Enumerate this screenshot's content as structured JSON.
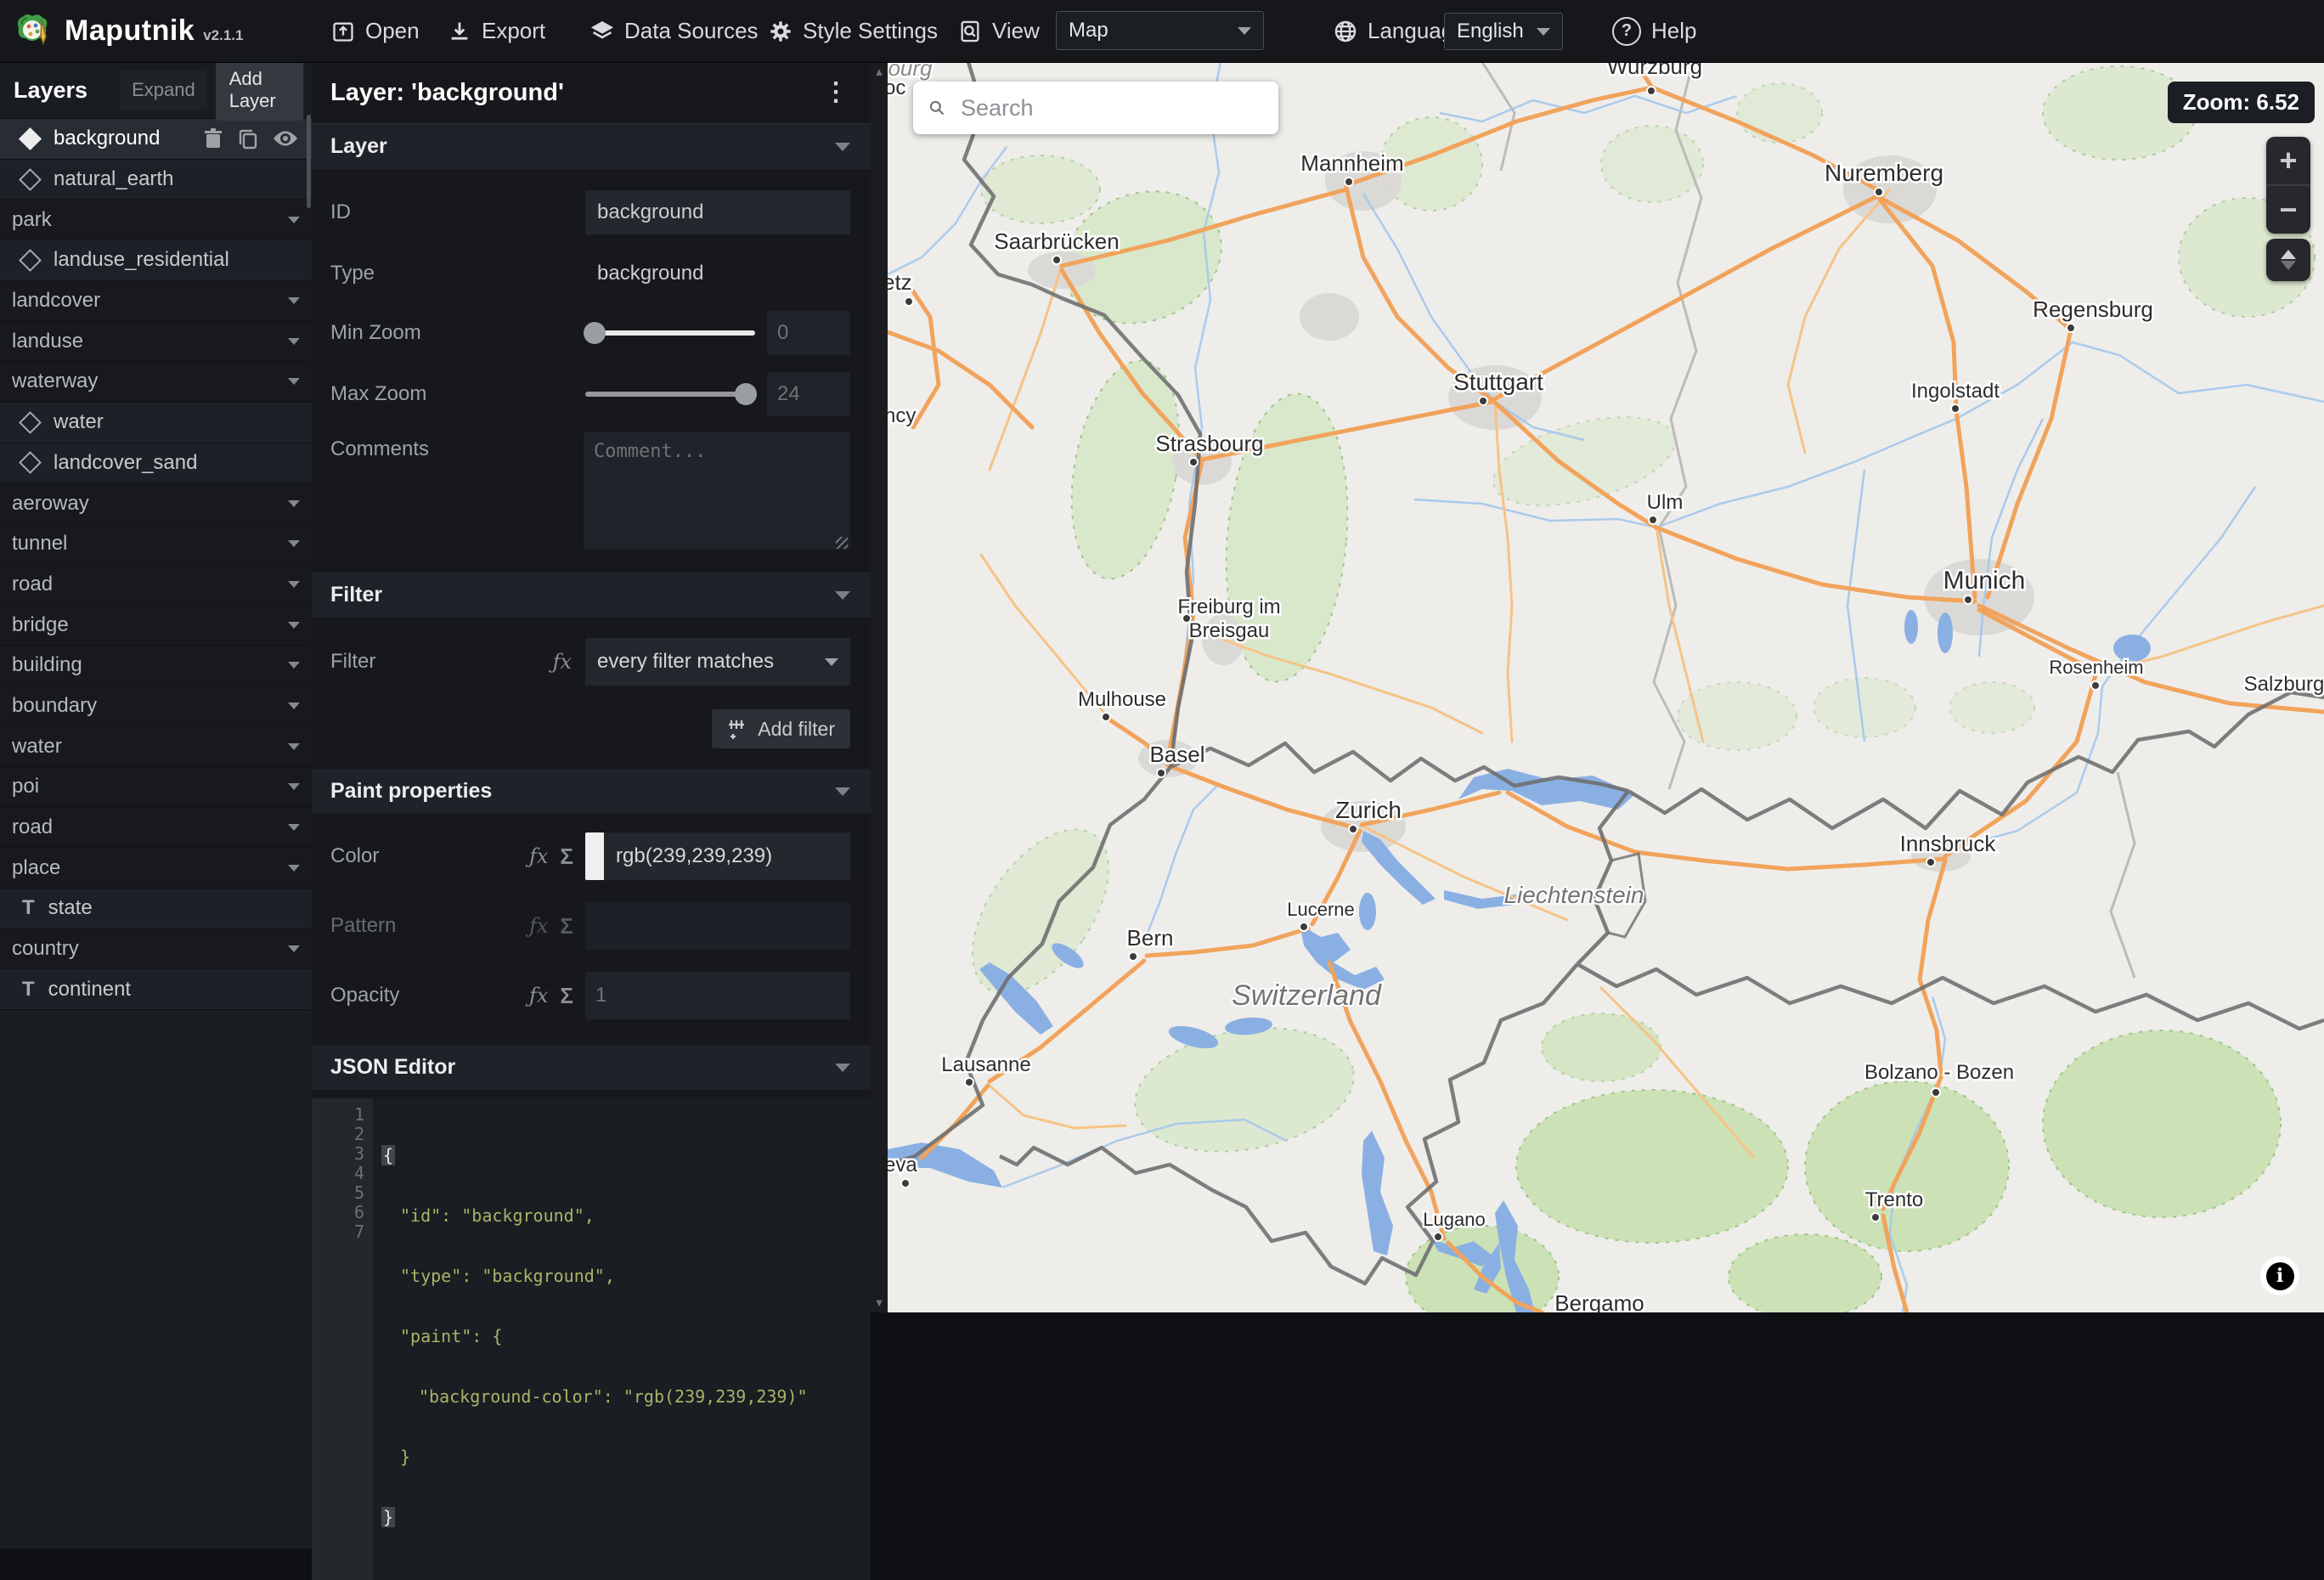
{
  "topbar": {
    "title": "Maputnik",
    "version": "v2.1.1",
    "open": "Open",
    "export": "Export",
    "data_sources": "Data Sources",
    "style_settings": "Style Settings",
    "view": "View",
    "view_select": "Map",
    "language": "Language",
    "language_select": "English",
    "help": "Help"
  },
  "sidebar": {
    "title": "Layers",
    "expand": "Expand",
    "add_layer": "Add Layer",
    "layers": [
      {
        "label": "background"
      },
      {
        "label": "natural_earth"
      },
      {
        "label": "park"
      },
      {
        "label": "landuse_residential"
      },
      {
        "label": "landcover"
      },
      {
        "label": "landuse"
      },
      {
        "label": "waterway"
      },
      {
        "label": "water"
      },
      {
        "label": "landcover_sand"
      },
      {
        "label": "aeroway"
      },
      {
        "label": "tunnel"
      },
      {
        "label": "road"
      },
      {
        "label": "bridge"
      },
      {
        "label": "building"
      },
      {
        "label": "boundary"
      },
      {
        "label": "water"
      },
      {
        "label": "poi"
      },
      {
        "label": "road"
      },
      {
        "label": "place"
      },
      {
        "label": "state"
      },
      {
        "label": "country"
      },
      {
        "label": "continent"
      }
    ]
  },
  "editor": {
    "title": "Layer: 'background'",
    "layer_section": "Layer",
    "id_label": "ID",
    "id_value": "background",
    "type_label": "Type",
    "type_value": "background",
    "min_zoom_label": "Min Zoom",
    "min_zoom_value": "0",
    "max_zoom_label": "Max Zoom",
    "max_zoom_value": "24",
    "comments_label": "Comments",
    "comments_placeholder": "Comment...",
    "filter_section": "Filter",
    "filter_label": "Filter",
    "filter_value": "every filter matches",
    "add_filter": "Add filter",
    "paint_section": "Paint properties",
    "color_label": "Color",
    "color_value": "rgb(239,239,239)",
    "color_swatch": "#efefef",
    "pattern_label": "Pattern",
    "opacity_label": "Opacity",
    "opacity_placeholder": "1",
    "json_section": "JSON Editor",
    "json_lines": [
      {
        "n": "1",
        "t": "{"
      },
      {
        "n": "2",
        "t": "\"id\": \"background\","
      },
      {
        "n": "3",
        "t": "\"type\": \"background\","
      },
      {
        "n": "4",
        "t": "\"paint\": {"
      },
      {
        "n": "5",
        "t": "\"background-color\": \"rgb(239,239,239)\""
      },
      {
        "n": "6",
        "t": "}"
      },
      {
        "n": "7",
        "t": "}"
      }
    ]
  },
  "map": {
    "search_placeholder": "Search",
    "zoom_badge": "Zoom: 6.52",
    "cities": [
      {
        "name": "Wurzburg"
      },
      {
        "name": "Mannheim"
      },
      {
        "name": "Nuremberg"
      },
      {
        "name": "Saarbrücken"
      },
      {
        "name": "Regensburg"
      },
      {
        "name": "Stuttgart"
      },
      {
        "name": "Ingolstadt"
      },
      {
        "name": "Strasbourg"
      },
      {
        "name": "Ulm"
      },
      {
        "name": "Munich"
      },
      {
        "name": "Freiburg im Breisgau",
        "line1": "Freiburg im",
        "line2": "Breisgau"
      },
      {
        "name": "Rosenheim"
      },
      {
        "name": "Salzburg"
      },
      {
        "name": "Mulhouse"
      },
      {
        "name": "Basel"
      },
      {
        "name": "Zurich"
      },
      {
        "name": "Innsbruck"
      },
      {
        "name": "Lucerne"
      },
      {
        "name": "Bern"
      },
      {
        "name": "Lausanne"
      },
      {
        "name": "Bolzano - Bozen"
      },
      {
        "name": "Trento"
      },
      {
        "name": "Lugano"
      },
      {
        "name": "Bergamo"
      }
    ],
    "edge_labels": [
      {
        "name": "bourg"
      },
      {
        "name": "oc"
      },
      {
        "name": "etz"
      },
      {
        "name": "ncy"
      },
      {
        "name": "eva"
      }
    ],
    "region_labels": [
      {
        "name": "Switzerland"
      },
      {
        "name": "Liechtenstein"
      }
    ]
  },
  "icons": {
    "help_q": "?",
    "kebab": "⋮",
    "fx": "ƒx",
    "sigma": "Σ",
    "plus": "+",
    "minus": "−",
    "up_arrow": "▲",
    "down_arrow": "▼",
    "info": "i",
    "t_glyph": "T"
  },
  "colors": {
    "topbar_bg": "#15171b",
    "panel_bg": "#16181c",
    "sidebar_bg": "#191c21",
    "selected_row_bg": "#282d34",
    "map_base": "#efedea",
    "map_water": "#8ab0e3",
    "map_green": "#d9e8cb",
    "map_green_south": "#c6e1ad",
    "map_road": "#f2a560",
    "map_urban": "#d9d8d5",
    "map_border": "#6d6d6d",
    "code_green": "#a9b468",
    "color_value_swatch": "#efefef"
  }
}
